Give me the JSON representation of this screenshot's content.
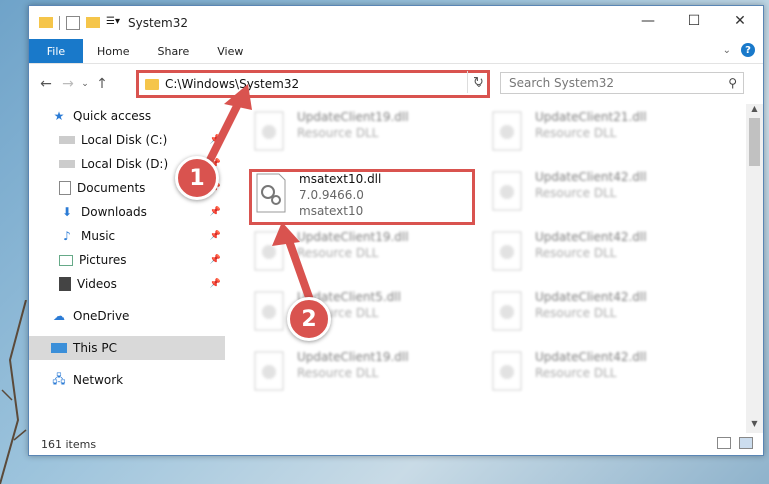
{
  "window": {
    "title": "System32"
  },
  "ribbon": {
    "tabs": [
      "File",
      "Home",
      "Share",
      "View"
    ]
  },
  "address": {
    "path": "C:\\Windows\\System32"
  },
  "search": {
    "placeholder": "Search System32"
  },
  "nav": {
    "items": [
      {
        "label": "Quick access",
        "icon": "star-icon",
        "pinned": false
      },
      {
        "label": "Local Disk (C:)",
        "icon": "drive-icon",
        "pinned": true
      },
      {
        "label": "Local Disk (D:)",
        "icon": "drive-icon",
        "pinned": true
      },
      {
        "label": "Documents",
        "icon": "documents-icon",
        "pinned": true
      },
      {
        "label": "Downloads",
        "icon": "downloads-icon",
        "pinned": true
      },
      {
        "label": "Music",
        "icon": "music-icon",
        "pinned": true
      },
      {
        "label": "Pictures",
        "icon": "pictures-icon",
        "pinned": true
      },
      {
        "label": "Videos",
        "icon": "videos-icon",
        "pinned": true
      },
      {
        "label": "OneDrive",
        "icon": "cloud-icon",
        "pinned": false
      },
      {
        "label": "This PC",
        "icon": "pc-icon",
        "pinned": false,
        "selected": true
      },
      {
        "label": "Network",
        "icon": "network-icon",
        "pinned": false
      }
    ]
  },
  "files": [
    {
      "name": "UpdateClient19.dll",
      "type": "Resource DLL",
      "blurred": true
    },
    {
      "name": "UpdateClient21.dll",
      "type": "Resource DLL",
      "blurred": true
    },
    {
      "name": "msatext10.dll",
      "version": "7.0.9466.0",
      "desc": "msatext10",
      "blurred": false
    },
    {
      "name": "UpdateClient42.dll",
      "type": "Resource DLL",
      "blurred": true
    },
    {
      "name": "UpdateClient19.dll",
      "type": "Resource DLL",
      "blurred": true
    },
    {
      "name": "UpdateClient42.dll",
      "type": "Resource DLL",
      "blurred": true
    },
    {
      "name": "UpdateClient5.dll",
      "type": "Resource DLL",
      "blurred": true
    },
    {
      "name": "UpdateClient42.dll",
      "type": "Resource DLL",
      "blurred": true
    },
    {
      "name": "UpdateClient19.dll",
      "type": "Resource DLL",
      "blurred": true
    },
    {
      "name": "UpdateClient42.dll",
      "type": "Resource DLL",
      "blurred": true
    }
  ],
  "status": {
    "count": "161 items"
  },
  "annotations": {
    "step1": "1",
    "step2": "2"
  },
  "colors": {
    "accent": "#1979ca",
    "annotation": "#d9534f"
  }
}
